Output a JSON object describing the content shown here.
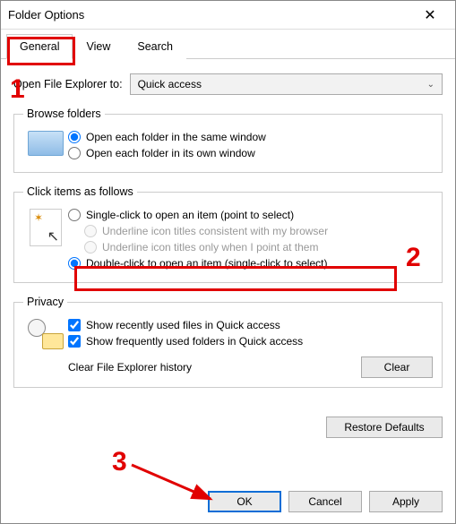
{
  "window": {
    "title": "Folder Options"
  },
  "tabs": {
    "general": "General",
    "view": "View",
    "search": "Search"
  },
  "open": {
    "label": "Open File Explorer to:",
    "value": "Quick access"
  },
  "browse": {
    "legend": "Browse folders",
    "same": "Open each folder in the same window",
    "own": "Open each folder in its own window"
  },
  "click": {
    "legend": "Click items as follows",
    "single": "Single-click to open an item (point to select)",
    "underline_browser": "Underline icon titles consistent with my browser",
    "underline_point": "Underline icon titles only when I point at them",
    "double": "Double-click to open an item (single-click to select)"
  },
  "privacy": {
    "legend": "Privacy",
    "recent_files": "Show recently used files in Quick access",
    "frequent_folders": "Show frequently used folders in Quick access",
    "clear_label": "Clear File Explorer history",
    "clear_btn": "Clear"
  },
  "buttons": {
    "restore": "Restore Defaults",
    "ok": "OK",
    "cancel": "Cancel",
    "apply": "Apply"
  },
  "annotations": {
    "n1": "1",
    "n2": "2",
    "n3": "3"
  }
}
